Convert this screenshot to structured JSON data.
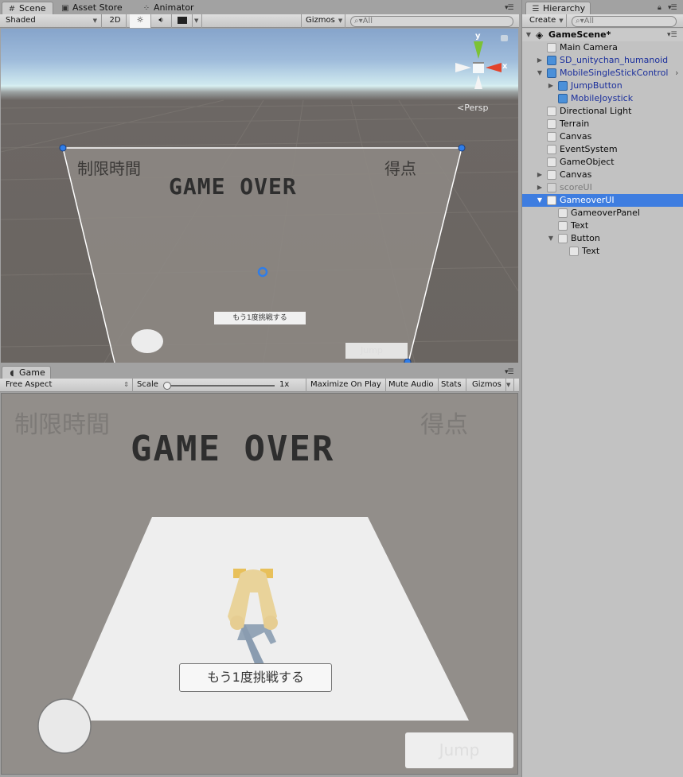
{
  "scene_panel": {
    "tabs": [
      {
        "label": "Scene",
        "icon": "grid-icon",
        "active": true
      },
      {
        "label": "Asset Store",
        "icon": "store-bag-icon",
        "active": false
      },
      {
        "label": "Animator",
        "icon": "animator-nodes-icon",
        "active": false
      }
    ],
    "toolbar": {
      "shading_mode": "Shaded",
      "mode_2d": "2D",
      "lighting_toggle": "sun-icon",
      "audio_toggle": "speaker-icon",
      "effects_toggle": "image-icon",
      "gizmos_label": "Gizmos",
      "search_placeholder": "All"
    },
    "orientation_gizmo": {
      "y_label": "y",
      "x_label": "x",
      "projection_label": "Persp"
    },
    "canvas_preview": {
      "time_label": "制限時間",
      "score_label": "得点",
      "gameover_text": "GAME OVER",
      "retry_button": "もう1度挑戦する",
      "jump_button": "Jump"
    }
  },
  "game_panel": {
    "tab": {
      "label": "Game",
      "icon": "pacman-icon"
    },
    "toolbar": {
      "aspect": "Free Aspect",
      "scale_label": "Scale",
      "scale_value": "1x",
      "scale_fraction": 0.0,
      "maximize_on_play": "Maximize On Play",
      "mute_audio": "Mute Audio",
      "stats": "Stats",
      "gizmos": "Gizmos"
    },
    "hud": {
      "time_label": "制限時間",
      "score_label": "得点",
      "gameover_text": "GAME OVER",
      "retry_button": "もう1度挑戦する",
      "jump_button": "Jump"
    },
    "colors": {
      "background": "#928e8a",
      "ground": "#eeeeee",
      "gameover_text": "#2e2e2e",
      "label_text": "#7d7a77"
    }
  },
  "hierarchy": {
    "tab_label": "Hierarchy",
    "create_label": "Create",
    "search_placeholder": "All",
    "scene_name": "GameScene*",
    "items": [
      {
        "label": "Main Camera",
        "depth": 1,
        "expander": "none",
        "type": "normal"
      },
      {
        "label": "SD_unitychan_humanoid",
        "depth": 1,
        "expander": "collapsed",
        "type": "prefab"
      },
      {
        "label": "MobileSingleStickControl",
        "depth": 1,
        "expander": "expanded",
        "type": "prefab"
      },
      {
        "label": "JumpButton",
        "depth": 2,
        "expander": "collapsed",
        "type": "prefab"
      },
      {
        "label": "MobileJoystick",
        "depth": 2,
        "expander": "none",
        "type": "prefab"
      },
      {
        "label": "Directional Light",
        "depth": 1,
        "expander": "none",
        "type": "normal"
      },
      {
        "label": "Terrain",
        "depth": 1,
        "expander": "none",
        "type": "normal"
      },
      {
        "label": "Canvas",
        "depth": 1,
        "expander": "none",
        "type": "normal"
      },
      {
        "label": "EventSystem",
        "depth": 1,
        "expander": "none",
        "type": "normal"
      },
      {
        "label": "GameObject",
        "depth": 1,
        "expander": "none",
        "type": "normal"
      },
      {
        "label": "Canvas",
        "depth": 1,
        "expander": "collapsed",
        "type": "normal"
      },
      {
        "label": "scoreUI",
        "depth": 1,
        "expander": "collapsed",
        "type": "inactive"
      },
      {
        "label": "GameoverUI",
        "depth": 1,
        "expander": "expanded",
        "type": "selected"
      },
      {
        "label": "GameoverPanel",
        "depth": 2,
        "expander": "none",
        "type": "normal"
      },
      {
        "label": "Text",
        "depth": 2,
        "expander": "none",
        "type": "normal"
      },
      {
        "label": "Button",
        "depth": 2,
        "expander": "expanded",
        "type": "normal"
      },
      {
        "label": "Text",
        "depth": 3,
        "expander": "none",
        "type": "normal"
      }
    ],
    "selected_color": "#3e7de0"
  }
}
